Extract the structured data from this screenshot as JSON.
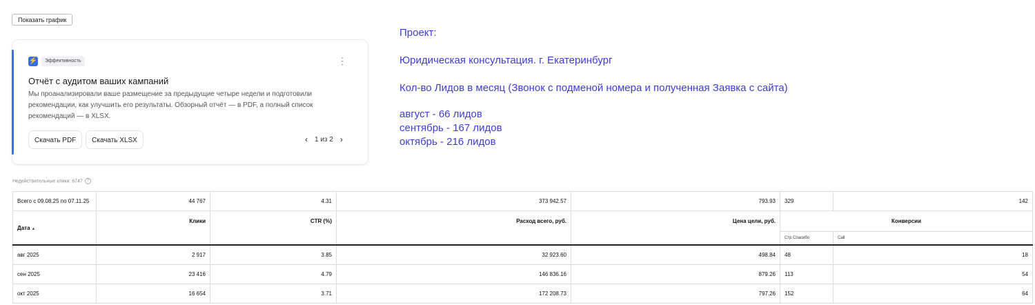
{
  "toolbar": {
    "show_chart": "Показать график"
  },
  "card": {
    "badge_icon": "⚡",
    "badge_label": "Эффективность",
    "more_icon": "⋮",
    "title": "Отчёт с аудитом ваших кампаний",
    "description": "Мы проанализировали ваше размещение за предыдущие четыре недели и подготовили рекомендации, как улучшить его результаты. Обзорный отчёт — в PDF, а полный список рекомендаций — в XLSX.",
    "download_pdf": "Скачать PDF",
    "download_xlsx": "Скачать XLSX",
    "prev_icon": "‹",
    "next_icon": "›",
    "pager": "1 из 2"
  },
  "note": {
    "line1": "Проект:",
    "line2": "Юридическая консультация. г. Екатеринбург",
    "line3": "Кол-во Лидов в месяц (Звонок с подменой номера и полученная Заявка с сайта)",
    "line4": "август - 66 лидов",
    "line5": "сентябрь - 167 лидов",
    "line6": "октябрь - 216 лидов"
  },
  "invalid_clicks": "Недействительные клики: 6747",
  "help_icon": "?",
  "table": {
    "totals": [
      "Всего с 09.08.25 по 07.11.25",
      "44 767",
      "4.31",
      "373 942.57",
      "793.93",
      "329",
      "142"
    ],
    "headers": {
      "date": "Дата",
      "sort_icon": "▲",
      "clicks": "Клики",
      "ctr": "CTR (%)",
      "spend": "Расход всего, руб.",
      "goal_cost": "Цена цели, руб.",
      "conversions": "Конверсии",
      "sub_thanks": "Стр Спасибо",
      "sub_call": "Call"
    },
    "rows": [
      [
        "авг 2025",
        "2 917",
        "3.85",
        "32 923.60",
        "498.84",
        "48",
        "18"
      ],
      [
        "сен 2025",
        "23 416",
        "4.79",
        "146 836.16",
        "879.26",
        "113",
        "54"
      ],
      [
        "окт 2025",
        "16 654",
        "3.71",
        "172 208.73",
        "797.26",
        "152",
        "64"
      ]
    ]
  }
}
